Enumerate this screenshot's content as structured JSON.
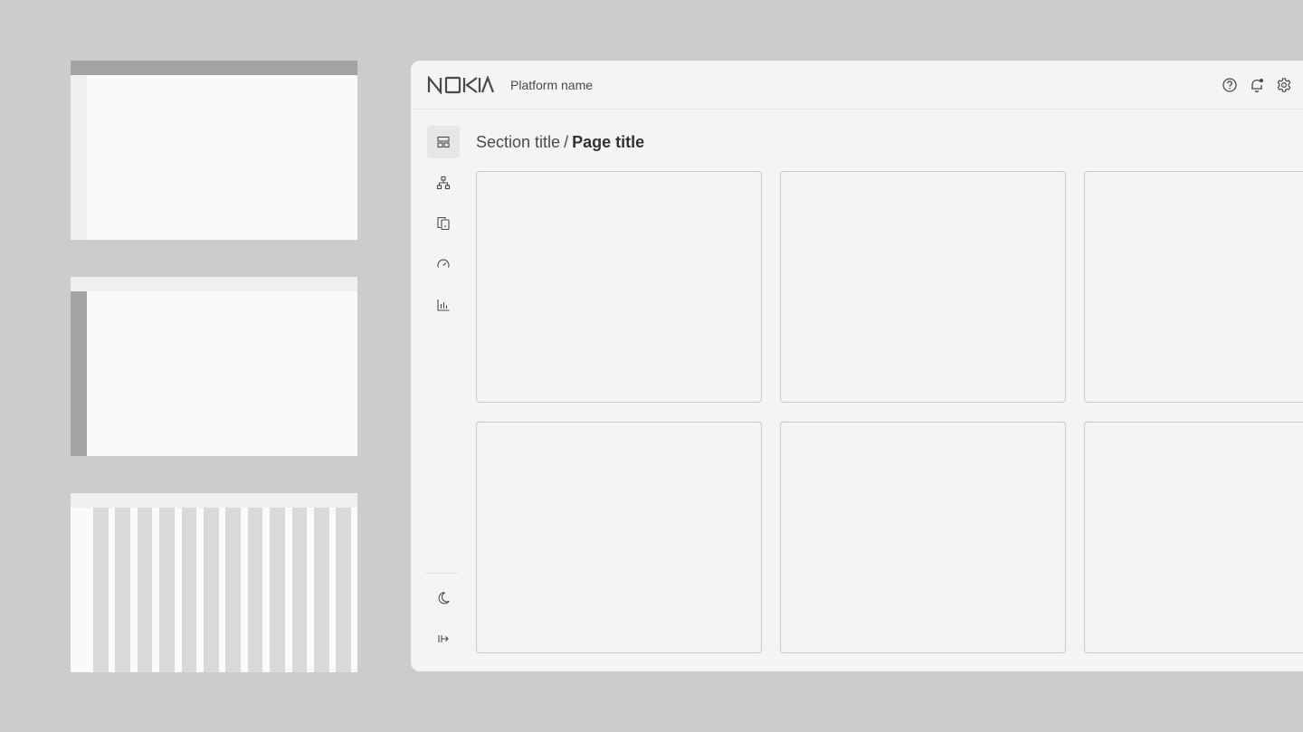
{
  "header": {
    "logo_text": "NOKIA",
    "platform_name": "Platform name",
    "actions": [
      {
        "icon": "help-icon"
      },
      {
        "icon": "bell-icon"
      },
      {
        "icon": "gear-icon"
      }
    ]
  },
  "nav": {
    "items": [
      {
        "icon": "dashboard-layout-icon",
        "active": true
      },
      {
        "icon": "network-topology-icon",
        "active": false
      },
      {
        "icon": "devices-icon",
        "active": false
      },
      {
        "icon": "speedometer-icon",
        "active": false
      },
      {
        "icon": "bar-chart-icon",
        "active": false
      }
    ],
    "bottom": [
      {
        "icon": "moon-icon"
      },
      {
        "icon": "expand-rail-icon"
      }
    ]
  },
  "breadcrumb": {
    "section": "Section title",
    "separator": "/",
    "page": "Page title"
  },
  "layout_thumbnails": [
    {
      "variant": "top-header-dark"
    },
    {
      "variant": "side-rail-dark"
    },
    {
      "variant": "column-grid"
    }
  ],
  "cards": [
    {
      "id": 1
    },
    {
      "id": 2
    },
    {
      "id": 3
    },
    {
      "id": 4
    },
    {
      "id": 5
    },
    {
      "id": 6
    }
  ],
  "colors": {
    "background": "#cccccc",
    "surface": "#f4f4f4",
    "border": "#c9c9c9",
    "accent_dark": "#a3a3a3",
    "text": "#4a4a4a"
  }
}
